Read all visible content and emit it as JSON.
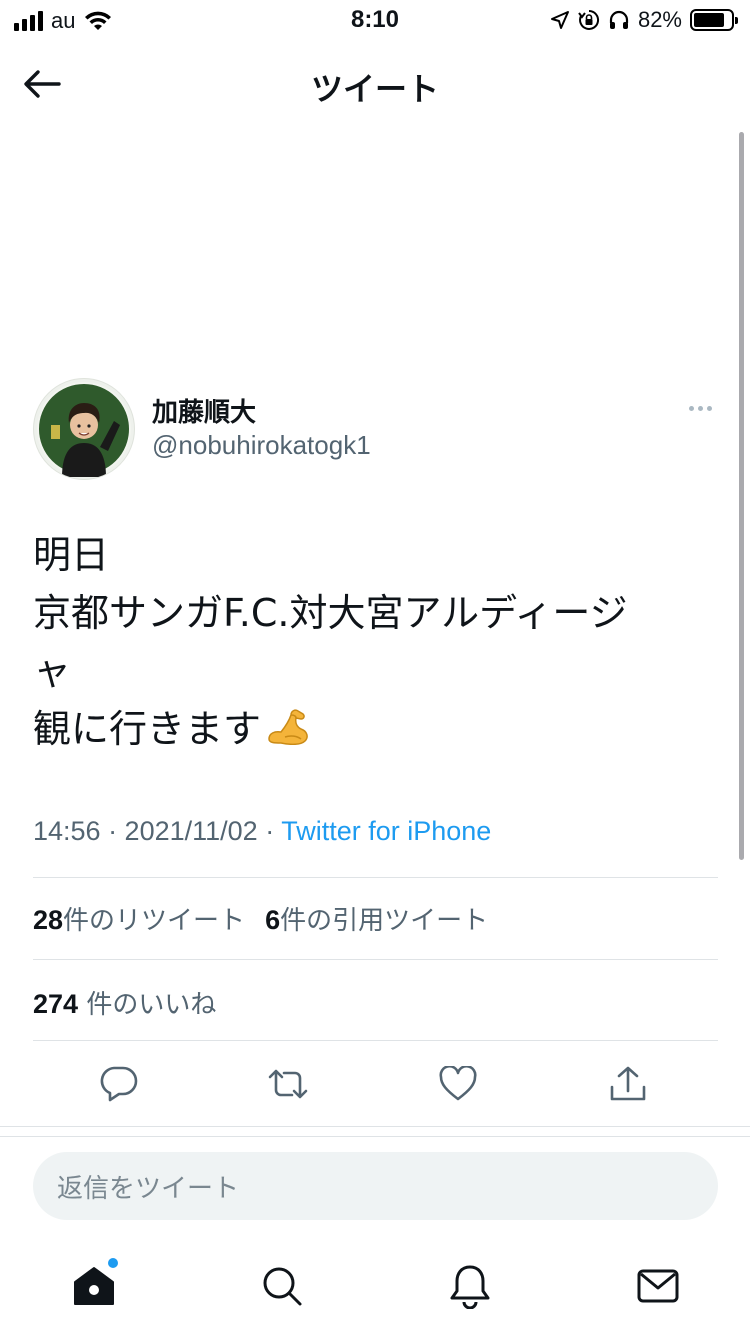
{
  "status_bar": {
    "carrier": "au",
    "time": "8:10",
    "battery_percent": "82%",
    "battery_level": 0.82,
    "icons": [
      "signal-bars-icon",
      "wifi-icon",
      "location-arrow-icon",
      "orientation-lock-icon",
      "headphones-icon",
      "battery-icon"
    ]
  },
  "header": {
    "title": "ツイート",
    "back_icon": "arrow-left-icon"
  },
  "tweet": {
    "author_name": "加藤順大",
    "author_handle": "@nobuhirokatogk1",
    "text_lines": [
      "明日",
      "京都サンガF.C.対大宮アルディージ",
      "ャ",
      "観に行きます"
    ],
    "emoji": "flexed-biceps-icon",
    "timestamp": "14:56 · 2021/11/02 · ",
    "source": "Twitter for iPhone",
    "retweet_count": "28",
    "retweet_label": "件のリツイート",
    "quote_count": "6",
    "quote_label": "件の引用ツイート",
    "like_count": "274",
    "like_label": "件のいいね"
  },
  "actions": [
    "reply-icon",
    "retweet-icon",
    "like-icon",
    "share-icon"
  ],
  "reply_box": {
    "placeholder": "返信をツイート"
  },
  "tab_bar": {
    "items": [
      "home-icon",
      "search-icon",
      "notifications-icon",
      "messages-icon"
    ],
    "home_has_new": true
  },
  "colors": {
    "accent": "#1d9bf0",
    "text_primary": "#0f1419",
    "text_secondary": "#536471",
    "divider": "#dfe3e6",
    "reply_bg": "#eff3f4"
  }
}
